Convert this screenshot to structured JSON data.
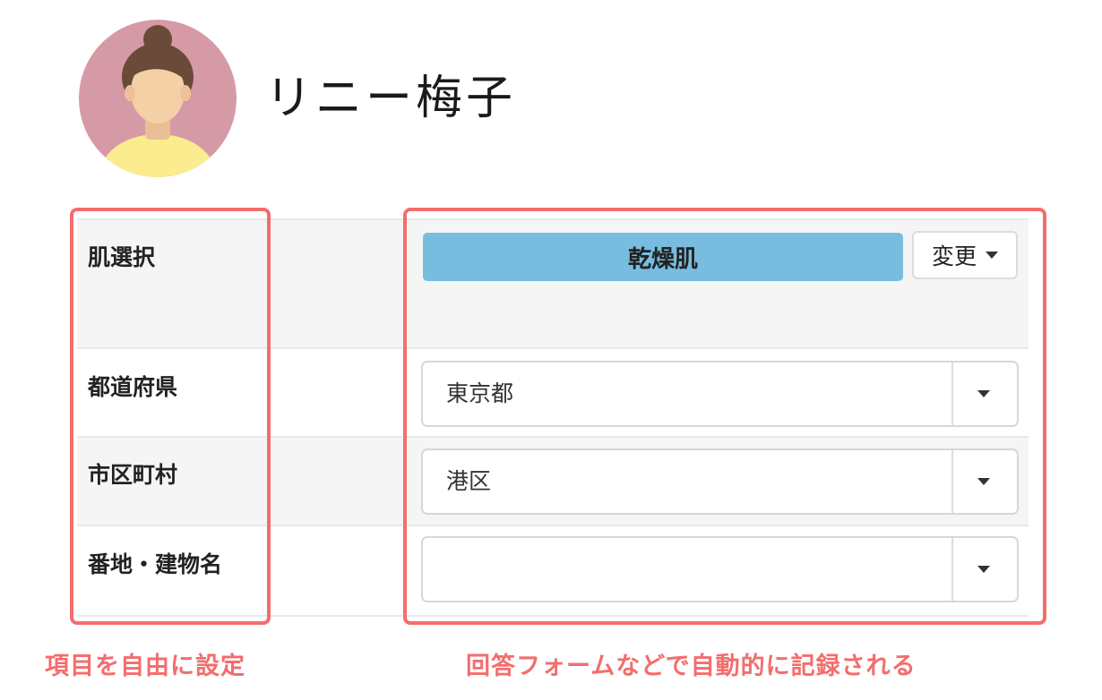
{
  "profile": {
    "name": "リニー梅子",
    "avatar_icon": "woman-avatar-icon"
  },
  "form": {
    "rows": [
      {
        "label": "肌選択"
      },
      {
        "label": "都道府県"
      },
      {
        "label": "市区町村"
      },
      {
        "label": "番地・建物名"
      }
    ],
    "skin": {
      "value": "乾燥肌",
      "change_label": "変更",
      "color": "#78bde0"
    },
    "prefecture": {
      "value": "東京都"
    },
    "city": {
      "value": "港区"
    },
    "address": {
      "value": ""
    }
  },
  "captions": {
    "left": "項目を自由に設定",
    "right": "回答フォームなどで自動的に記録される",
    "color": "#f46d6d"
  }
}
